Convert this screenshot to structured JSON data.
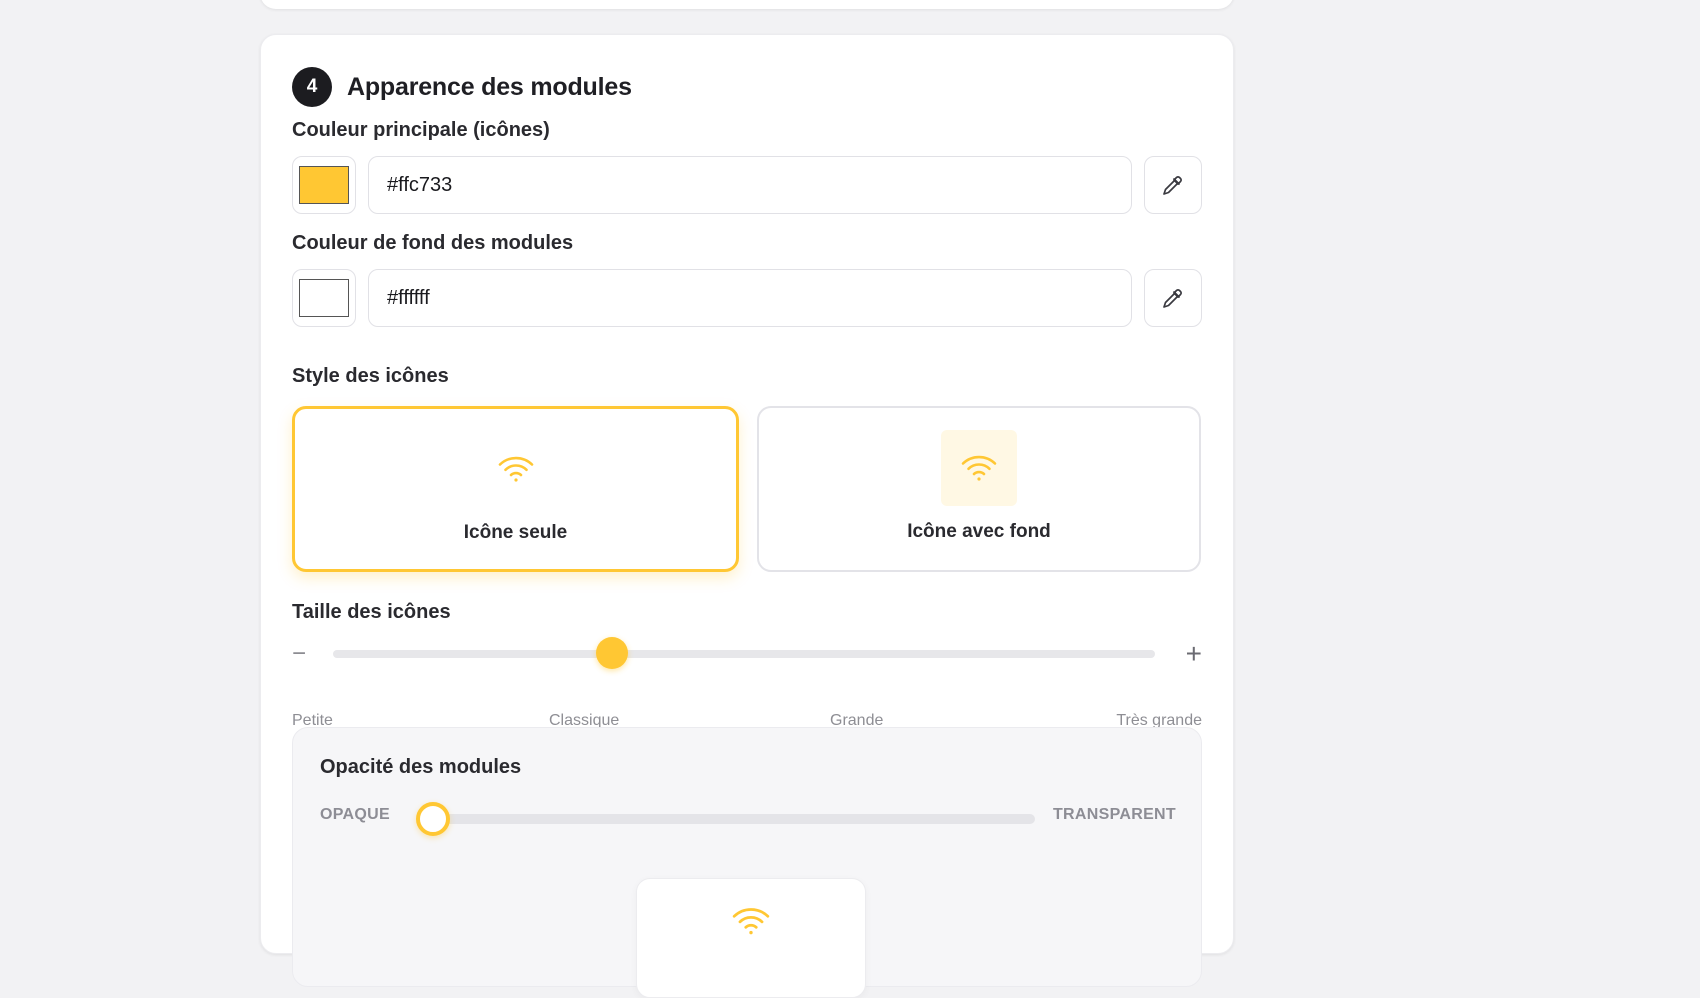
{
  "section": {
    "number": "4",
    "title": "Apparence des modules"
  },
  "primary_color": {
    "label": "Couleur principale (icônes)",
    "value": "#ffc733",
    "swatch": "#ffc733"
  },
  "background_color": {
    "label": "Couleur de fond des modules",
    "value": "#ffffff",
    "swatch": "#ffffff"
  },
  "icon_style": {
    "label": "Style des icônes",
    "options": [
      {
        "label": "Icône seule",
        "selected": true,
        "icon": "wifi-icon"
      },
      {
        "label": "Icône avec fond",
        "selected": false,
        "icon": "wifi-icon"
      }
    ]
  },
  "icon_size": {
    "label": "Taille des icônes",
    "minus": "−",
    "plus": "+",
    "ticks": [
      "Petite",
      "Classique",
      "Grande",
      "Très grande"
    ],
    "value": "Classique",
    "fraction": 0.34
  },
  "opacity": {
    "title": "Opacité des modules",
    "left_label": "OPAQUE",
    "right_label": "TRANSPARENT",
    "fraction": 0.0
  },
  "colors": {
    "accent": "#ffc733",
    "accent_soft": "#fff8e4",
    "text": "#1f1f24",
    "muted": "#8e8e94"
  }
}
